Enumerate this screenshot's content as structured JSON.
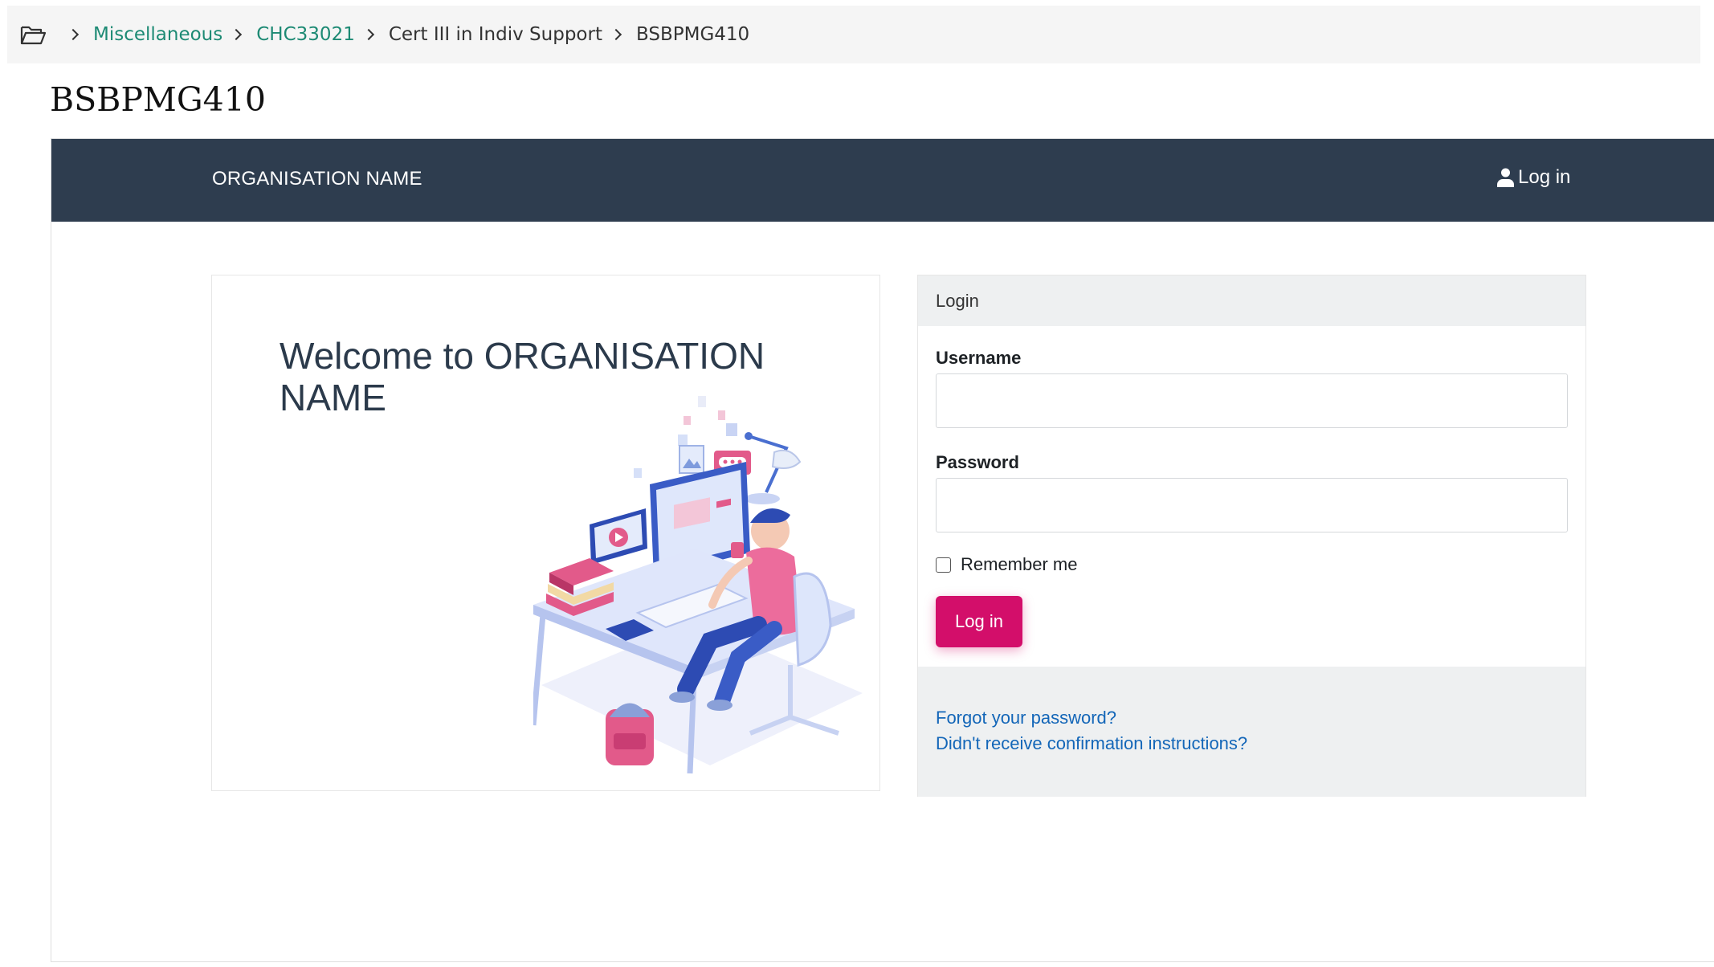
{
  "breadcrumb": {
    "icon": "folder-open-icon",
    "items": [
      {
        "label": "Miscellaneous",
        "link": true
      },
      {
        "label": "CHC33021",
        "link": true
      },
      {
        "label": "Cert III in Indiv Support",
        "link": false
      },
      {
        "label": "BSBPMG410",
        "link": false
      }
    ]
  },
  "page": {
    "title": "BSBPMG410"
  },
  "navbar": {
    "org_name": "ORGANISATION NAME",
    "login_label": "Log in",
    "background": "#2e3d4f"
  },
  "welcome": {
    "heading": "Welcome to ORGANISATION NAME"
  },
  "login": {
    "header": "Login",
    "username_label": "Username",
    "username_value": "",
    "password_label": "Password",
    "password_value": "",
    "remember_label": "Remember me",
    "remember_checked": false,
    "button_label": "Log in",
    "button_color": "#d30e6a",
    "forgot_link": "Forgot your password?",
    "confirmation_link": "Didn't receive confirmation instructions?"
  }
}
